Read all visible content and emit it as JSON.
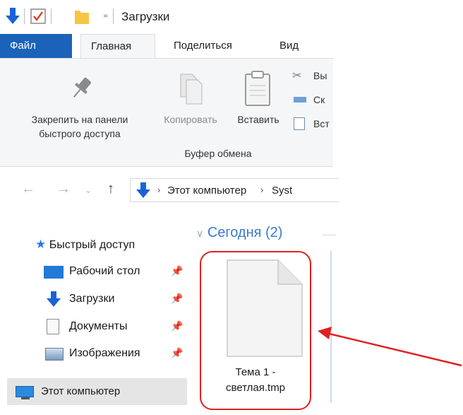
{
  "window": {
    "title": "Загрузки"
  },
  "ribbon": {
    "tabs": [
      "Файл",
      "Главная",
      "Поделиться",
      "Вид"
    ],
    "pin_label_line1": "Закрепить на панели",
    "pin_label_line2": "быстрого доступа",
    "copy_label": "Копировать",
    "paste_label": "Вставить",
    "side_items": [
      "Вы",
      "Ск",
      "Вст"
    ],
    "group_label": "Буфер обмена"
  },
  "address": {
    "crumbs": [
      "Этот компьютер",
      "Syst"
    ]
  },
  "navpane": {
    "quick_access": "Быстрый доступ",
    "items": [
      "Рабочий стол",
      "Загрузки",
      "Документы",
      "Изображения"
    ],
    "this_pc": "Этот компьютер"
  },
  "content": {
    "section_header": "Сегодня (2)",
    "file_name_line1": "Тема 1 -",
    "file_name_line2": "светлая.tmp"
  },
  "colors": {
    "accent": "#1a63b9",
    "highlight": "#e02020",
    "section": "#3a7bd0"
  }
}
